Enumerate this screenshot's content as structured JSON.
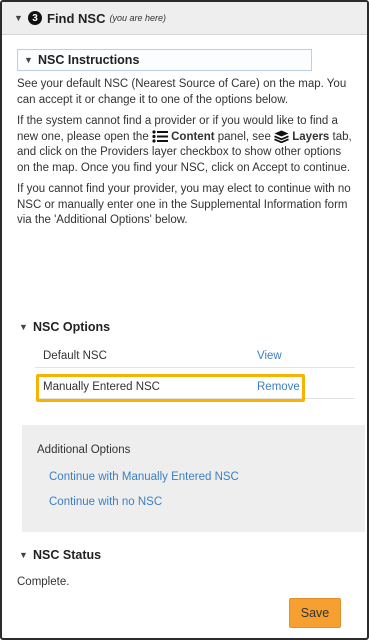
{
  "header": {
    "step_number": "3",
    "title": "Find NSC",
    "subtitle": "(you are here)"
  },
  "instructions": {
    "title": "NSC Instructions",
    "p1": "See your default NSC (Nearest Source of Care) on the map. You can accept it or change it to one of the options below.",
    "p2_a": "If the system cannot find a provider or if you would like to find a new one, please open the",
    "p2_content": "Content",
    "p2_b": "panel, see",
    "p2_layers": "Layers",
    "p2_c": "tab, and click on the Providers layer checkbox to show other options on the map. Once you find your NSC, click on Accept to continue.",
    "p3": "If you cannot find your provider, you may elect to continue with no NSC or manually enter one in the Supplemental Information form via the 'Additional Options' below."
  },
  "options": {
    "title": "NSC Options",
    "rows": [
      {
        "label": "Default NSC",
        "action": "View"
      },
      {
        "label": "Manually Entered NSC",
        "action": "Remove"
      }
    ]
  },
  "additional": {
    "title": "Additional Options",
    "links": [
      "Continue with Manually Entered NSC",
      "Continue with no NSC"
    ]
  },
  "status": {
    "title": "NSC Status",
    "value": "Complete."
  },
  "save_label": "Save",
  "colors": {
    "link": "#3b7fc4",
    "highlight": "#f6b400",
    "save_button": "#f5a030",
    "panel_header_bg": "#eeeeee"
  }
}
